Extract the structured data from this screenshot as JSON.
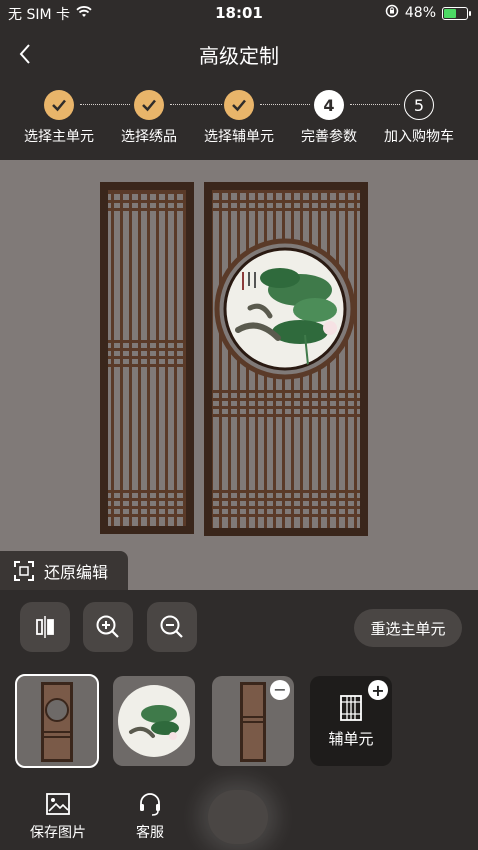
{
  "status_bar": {
    "carrier": "无 SIM 卡",
    "time": "18:01",
    "battery": "48%",
    "battery_level": 0.48
  },
  "nav": {
    "title": "高级定制"
  },
  "steps": [
    {
      "label": "选择主单元",
      "state": "done"
    },
    {
      "label": "选择绣品",
      "state": "done"
    },
    {
      "label": "选择辅单元",
      "state": "done"
    },
    {
      "label": "完善参数",
      "state": "active",
      "number": "4"
    },
    {
      "label": "加入购物车",
      "state": "todo",
      "number": "5"
    }
  ],
  "canvas": {
    "restore_label": "还原编辑"
  },
  "toolbar": {
    "reselect_label": "重选主单元"
  },
  "thumbnails": {
    "add_aux_label": "辅单元",
    "remove_glyph": "−",
    "add_glyph": "+"
  },
  "bottom_bar": {
    "save_image_label": "保存图片",
    "service_label": "客服"
  },
  "colors": {
    "accent": "#e9b56a",
    "panel": "#2f2c2b",
    "canvas": "#807a78",
    "wood": "#5a3a28"
  }
}
